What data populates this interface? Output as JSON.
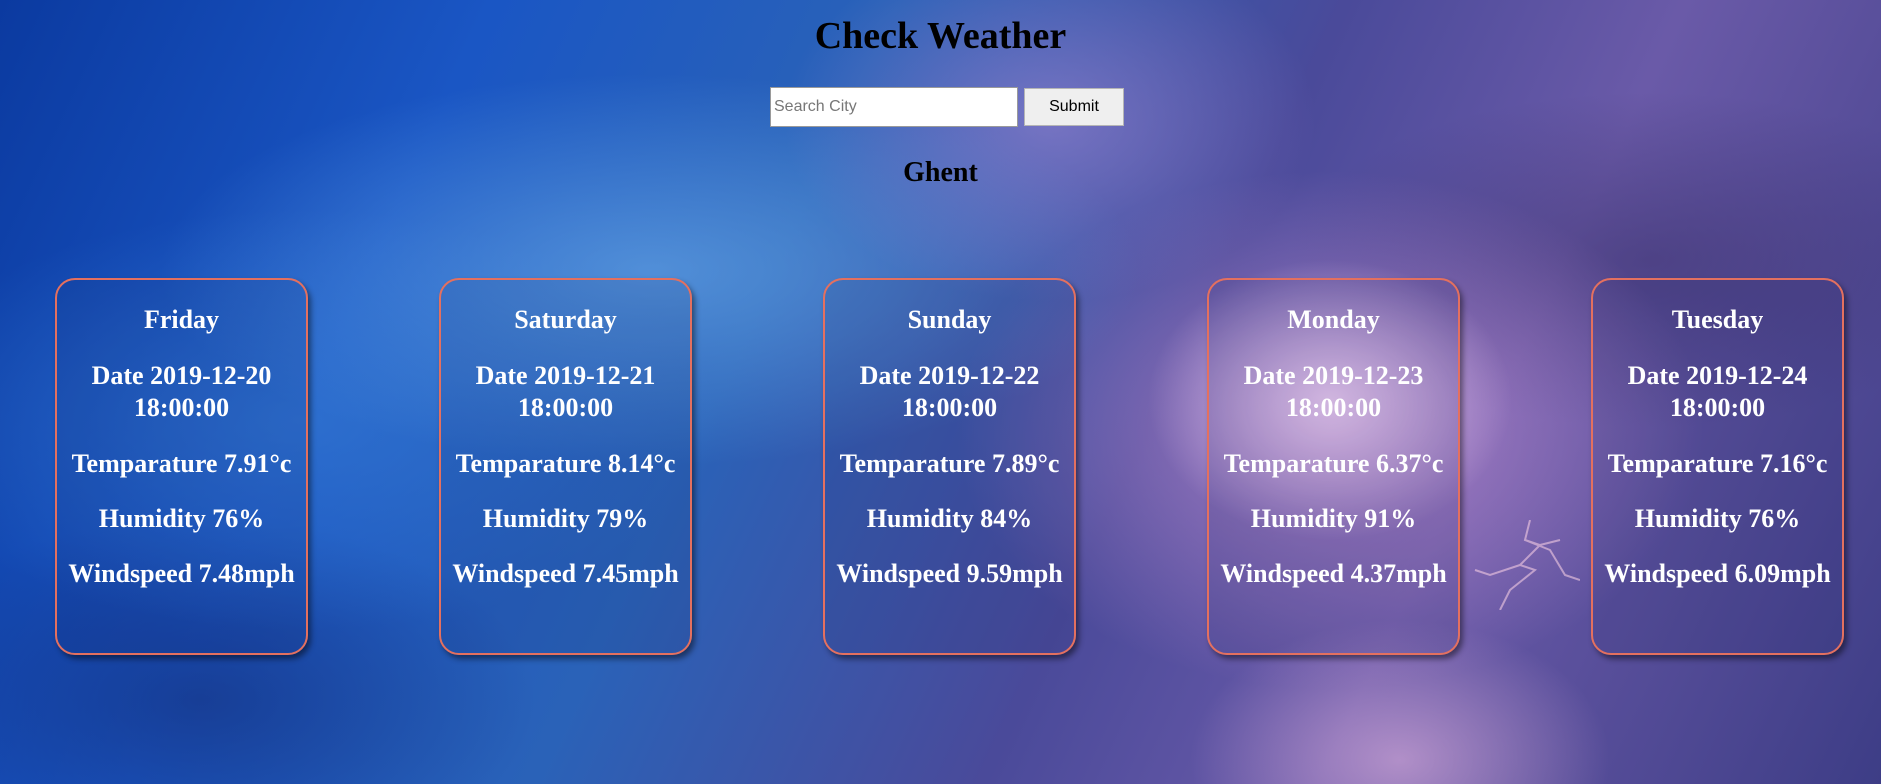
{
  "header": {
    "title": "Check Weather"
  },
  "search": {
    "placeholder": "Search City",
    "value": "",
    "submit_label": "Submit"
  },
  "city": "Ghent",
  "forecast": [
    {
      "day": "Friday",
      "date": "Date 2019-12-20 18:00:00",
      "temperature": "Temparature 7.91°c",
      "humidity": "Humidity 76%",
      "windspeed": "Windspeed 7.48mph"
    },
    {
      "day": "Saturday",
      "date": "Date 2019-12-21 18:00:00",
      "temperature": "Temparature 8.14°c",
      "humidity": "Humidity 79%",
      "windspeed": "Windspeed 7.45mph"
    },
    {
      "day": "Sunday",
      "date": "Date 2019-12-22 18:00:00",
      "temperature": "Temparature 7.89°c",
      "humidity": "Humidity 84%",
      "windspeed": "Windspeed 9.59mph"
    },
    {
      "day": "Monday",
      "date": "Date 2019-12-23 18:00:00",
      "temperature": "Temparature 6.37°c",
      "humidity": "Humidity 91%",
      "windspeed": "Windspeed 4.37mph"
    },
    {
      "day": "Tuesday",
      "date": "Date 2019-12-24 18:00:00",
      "temperature": "Temparature 7.16°c",
      "humidity": "Humidity 76%",
      "windspeed": "Windspeed 6.09mph"
    }
  ],
  "colors": {
    "card_border": "#e4705f",
    "card_text": "#ffffff",
    "title_text": "#000000"
  },
  "background": {
    "icon": "storm-cloud-background-image"
  }
}
